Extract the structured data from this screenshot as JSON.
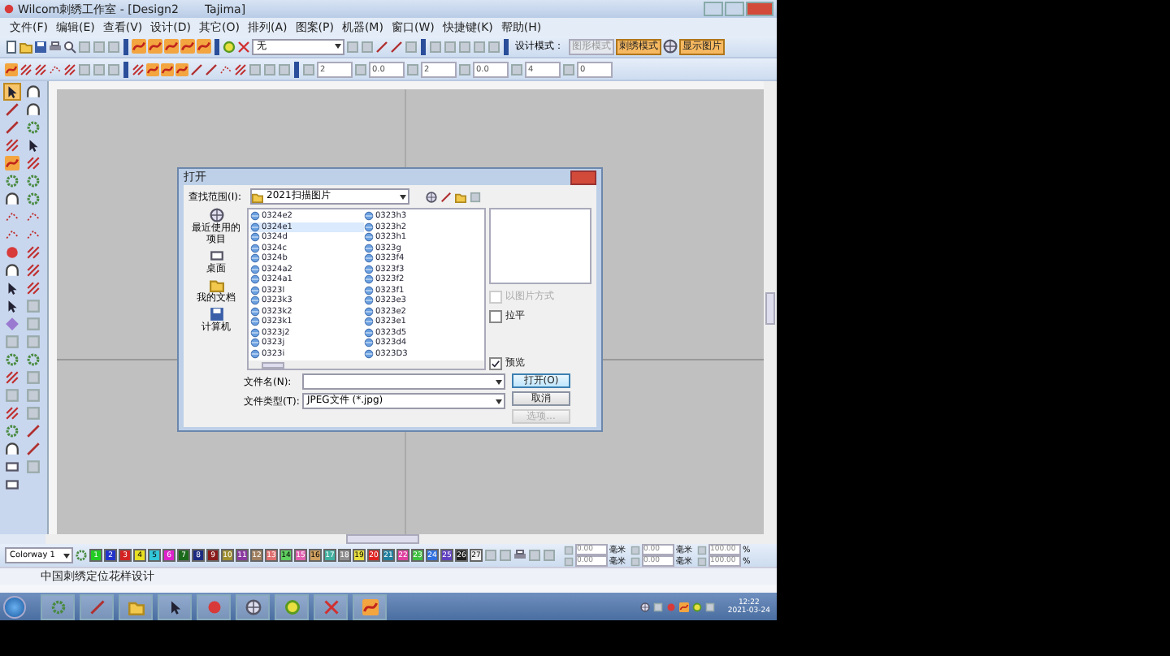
{
  "window": {
    "title": "Wilcom刺绣工作室 - [Design2",
    "title_suffix": "Tajima]"
  },
  "menu": [
    "文件(F)",
    "编辑(E)",
    "查看(V)",
    "设计(D)",
    "其它(O)",
    "排列(A)",
    "图案(P)",
    "机器(M)",
    "窗口(W)",
    "快捷键(K)",
    "帮助(H)"
  ],
  "toolbar": {
    "stitch_dropdown": "无",
    "mode_label": "设计模式：",
    "modes": [
      {
        "label": "图形模式",
        "selected": false
      },
      {
        "label": "刺绣模式",
        "selected": true
      }
    ],
    "show_picture": {
      "label": "显示图片",
      "on": true
    }
  },
  "toolbar2": {
    "fields": [
      "2",
      "0.0",
      "2",
      "0.0",
      "4",
      "0"
    ]
  },
  "dialog": {
    "title": "打开",
    "look_in_label": "查找范围(I):",
    "look_in": "2021扫描图片",
    "places": [
      "最近使用的项目",
      "桌面",
      "我的文档",
      "计算机"
    ],
    "files": [
      {
        "name": "0324e2",
        "selected": false
      },
      {
        "name": "0324e1",
        "selected": true
      },
      {
        "name": "0324d",
        "selected": false
      },
      {
        "name": "0324c",
        "selected": false
      },
      {
        "name": "0324b",
        "selected": false
      },
      {
        "name": "0324a2",
        "selected": false
      },
      {
        "name": "0324a1",
        "selected": false
      },
      {
        "name": "0323l",
        "selected": false
      },
      {
        "name": "0323k3",
        "selected": false
      },
      {
        "name": "0323k2",
        "selected": false
      },
      {
        "name": "0323k1",
        "selected": false
      },
      {
        "name": "0323j2",
        "selected": false
      },
      {
        "name": "0323j",
        "selected": false
      },
      {
        "name": "0323i",
        "selected": false
      },
      {
        "name": "0323h3",
        "selected": false
      },
      {
        "name": "0323h2",
        "selected": false
      },
      {
        "name": "0323h1",
        "selected": false
      },
      {
        "name": "0323g",
        "selected": false
      },
      {
        "name": "0323f4",
        "selected": false
      },
      {
        "name": "0323f3",
        "selected": false
      },
      {
        "name": "0323f2",
        "selected": false
      },
      {
        "name": "0323f1",
        "selected": false
      },
      {
        "name": "0323e3",
        "selected": false
      },
      {
        "name": "0323e2",
        "selected": false
      },
      {
        "name": "0323e1",
        "selected": false
      },
      {
        "name": "0323d5",
        "selected": false
      },
      {
        "name": "0323d4",
        "selected": false
      },
      {
        "name": "0323D3",
        "selected": false
      }
    ],
    "options": [
      {
        "label": "以图片方式",
        "checked": false,
        "disabled": true
      },
      {
        "label": "拉平",
        "checked": false,
        "disabled": false
      },
      {
        "label": "预览",
        "checked": true,
        "disabled": false
      }
    ],
    "filename_label": "文件名(N):",
    "filetype_label": "文件类型(T):",
    "filetype": "JPEG文件 (*.jpg)",
    "buttons": [
      {
        "label": "打开(O)",
        "disabled": false
      },
      {
        "label": "取消",
        "disabled": false
      },
      {
        "label": "选项...",
        "disabled": true
      }
    ]
  },
  "colorbar": {
    "colorway": "Colorway 1",
    "swatches": [
      {
        "label": "1",
        "color": "#22cc22"
      },
      {
        "label": "2",
        "color": "#2233cc"
      },
      {
        "label": "3",
        "color": "#d42222"
      },
      {
        "label": "4",
        "color": "#e8e022"
      },
      {
        "label": "5",
        "color": "#33c6d8"
      },
      {
        "label": "6",
        "color": "#dd22cc"
      },
      {
        "label": "7",
        "color": "#1b6a1b"
      },
      {
        "label": "8",
        "color": "#1b2a80"
      },
      {
        "label": "9",
        "color": "#8a1b1b"
      },
      {
        "label": "10",
        "color": "#a09030"
      },
      {
        "label": "11",
        "color": "#8a3aa0"
      },
      {
        "label": "12",
        "color": "#a08060"
      },
      {
        "label": "13",
        "color": "#e07070"
      },
      {
        "label": "14",
        "color": "#60d060"
      },
      {
        "label": "15",
        "color": "#e060b0"
      },
      {
        "label": "16",
        "color": "#d0a060"
      },
      {
        "label": "17",
        "color": "#40b0a0"
      },
      {
        "label": "18",
        "color": "#909090"
      },
      {
        "label": "19",
        "color": "#e8e040"
      },
      {
        "label": "20",
        "color": "#e02020"
      },
      {
        "label": "21",
        "color": "#2080a0"
      },
      {
        "label": "22",
        "color": "#e040a0"
      },
      {
        "label": "23",
        "color": "#40c040"
      },
      {
        "label": "24",
        "color": "#3070e0"
      },
      {
        "label": "25",
        "color": "#6040c0"
      },
      {
        "label": "26",
        "color": "#202020"
      },
      {
        "label": "27",
        "color": "#f0f0f0"
      }
    ],
    "fields": [
      [
        "0.00",
        "毫米",
        "0.00",
        "毫米",
        "100.00",
        "%"
      ],
      [
        "0.00",
        "毫米",
        "0.00",
        "毫米",
        "100.00",
        "%"
      ]
    ]
  },
  "status_bar": "中国刺绣定位花样设计",
  "taskbar": {
    "time": "12:22",
    "date": "2021-03-24"
  }
}
